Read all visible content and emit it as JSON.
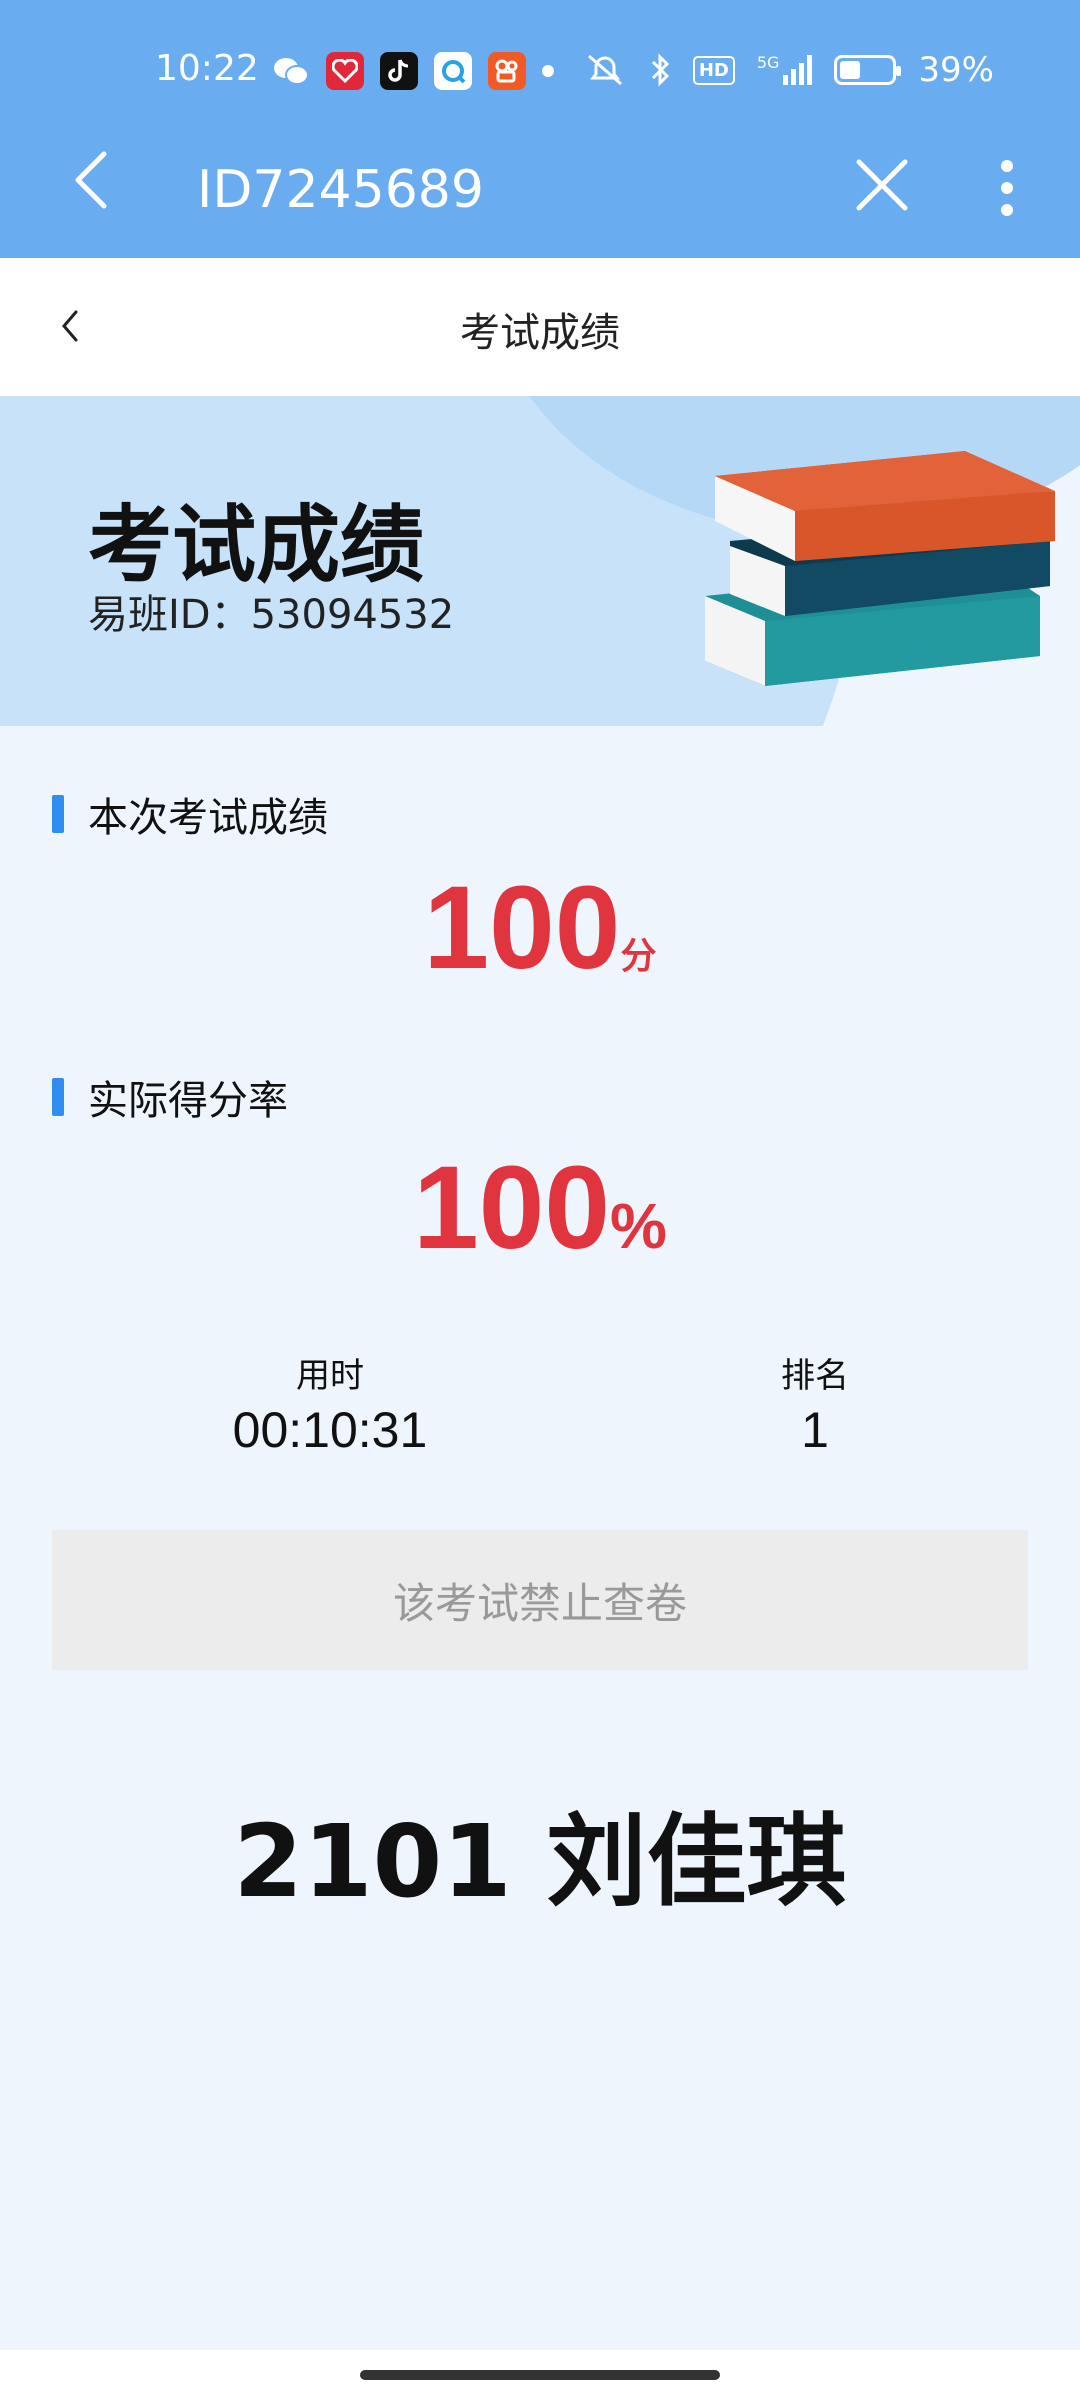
{
  "status_bar": {
    "time": "10:22",
    "network": "5G",
    "battery_text": "39%",
    "battery_level": 0.39,
    "notification_icons": [
      "wechat-icon",
      "app-red-icon",
      "douyin-icon",
      "browser-icon",
      "kuaishou-icon"
    ]
  },
  "app_bar": {
    "title": "ID7245689"
  },
  "page_header": {
    "title": "考试成绩"
  },
  "hero": {
    "title": "考试成绩",
    "user_id": "易班ID：53094532"
  },
  "score_section": {
    "label": "本次考试成绩",
    "value": "100",
    "unit": "分"
  },
  "rate_section": {
    "label": "实际得分率",
    "value": "100",
    "unit": "%"
  },
  "stats": {
    "time_label": "用时",
    "time_value": "00:10:31",
    "rank_label": "排名",
    "rank_value": "1"
  },
  "notice": "该考试禁止查卷",
  "student_name": "2101 刘佳琪",
  "colors": {
    "primary_blue": "#6aacf0",
    "score_red": "#e0343f",
    "accent_bar": "#2f8ef0"
  }
}
